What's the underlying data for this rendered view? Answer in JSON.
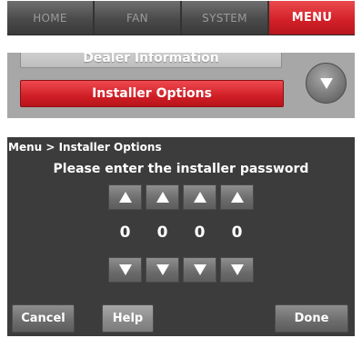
{
  "nav": {
    "tabs": [
      {
        "label": "HOME",
        "active": false
      },
      {
        "label": "FAN",
        "active": false
      },
      {
        "label": "SYSTEM",
        "active": false
      },
      {
        "label": "MENU",
        "active": true
      }
    ]
  },
  "menu_list": {
    "items": [
      {
        "label": "Dealer Information",
        "selected": false
      },
      {
        "label": "Installer Options",
        "selected": true
      }
    ],
    "scroll_icon": "down-triangle-icon"
  },
  "password_screen": {
    "breadcrumb": "Menu > Installer Options",
    "prompt": "Please enter the installer password",
    "digits": [
      "0",
      "0",
      "0",
      "0"
    ],
    "up_icon": "up-triangle-icon",
    "down_icon": "down-triangle-icon",
    "buttons": {
      "cancel": "Cancel",
      "help": "Help",
      "done": "Done"
    }
  },
  "colors": {
    "accent_red": "#d11f27",
    "panel_dark": "#3c3c3c",
    "panel_light": "#a7a7a7"
  }
}
